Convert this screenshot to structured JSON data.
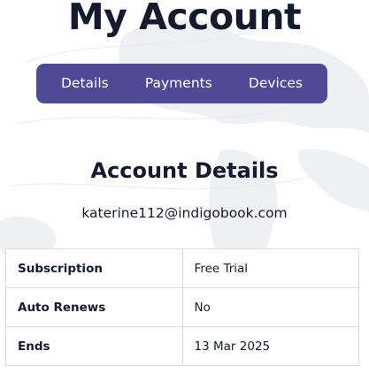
{
  "page": {
    "title": "My Account"
  },
  "tabs": [
    {
      "label": "Details"
    },
    {
      "label": "Payments"
    },
    {
      "label": "Devices"
    }
  ],
  "account": {
    "heading": "Account Details",
    "email": "katerine112@indigobook.com",
    "rows": [
      {
        "label": "Subscription",
        "value": "Free Trial"
      },
      {
        "label": "Auto Renews",
        "value": "No"
      },
      {
        "label": "Ends",
        "value": "13 Mar 2025"
      }
    ]
  },
  "colors": {
    "tab_bar": "#4e4a96",
    "text": "#161a2e",
    "border": "#dcdcdc",
    "background_map": "#eef0f4"
  }
}
